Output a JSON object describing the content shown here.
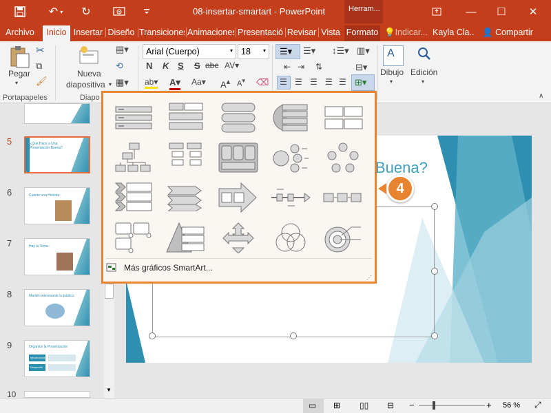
{
  "titlebar": {
    "doc_title": "08-insertar-smartart  -  PowerPoint",
    "context_tab": "Herram...",
    "colors": {
      "accent": "#c43e1c",
      "context": "#a8321a"
    }
  },
  "tabs": [
    "Archivo",
    "Inicio",
    "Insertar",
    "Diseño",
    "Transiciones",
    "Animaciones",
    "Presentació",
    "Revisar",
    "Vista",
    "Formato"
  ],
  "tell_me": "Indicar...",
  "user": "Kayla Cla...",
  "share": "Compartir",
  "ribbon": {
    "paste": "Pegar",
    "clipboard_group": "Portapapeles",
    "new_slide_1": "Nueva",
    "new_slide_2": "diapositiva",
    "slides_group": "Diapo",
    "font_name": "Arial (Cuerpo)",
    "font_size": "18",
    "bold": "N",
    "italic": "K",
    "underline": "S",
    "strike": "S",
    "spacing": "abc",
    "case": "Aa",
    "drawing": "Dibujo",
    "editing": "Edición"
  },
  "slides": [
    {
      "num": "5",
      "title": "¿Qué Hace a Una Presentación Buena?"
    },
    {
      "num": "6",
      "title": "Cuente una Historia"
    },
    {
      "num": "7",
      "title": "Hay la Tema"
    },
    {
      "num": "8",
      "title": "Mantén interesante tu público"
    },
    {
      "num": "9",
      "title": "Organice la Presentación"
    },
    {
      "num": "10",
      "title": ""
    }
  ],
  "slide9_labels": [
    "Introducción",
    "Desarrollo"
  ],
  "slide_title_partial": "Buena?",
  "gallery": {
    "more": "Más gráficos SmartArt...",
    "more_underline": "M"
  },
  "callout": "4",
  "status": {
    "zoom": "56 %"
  }
}
